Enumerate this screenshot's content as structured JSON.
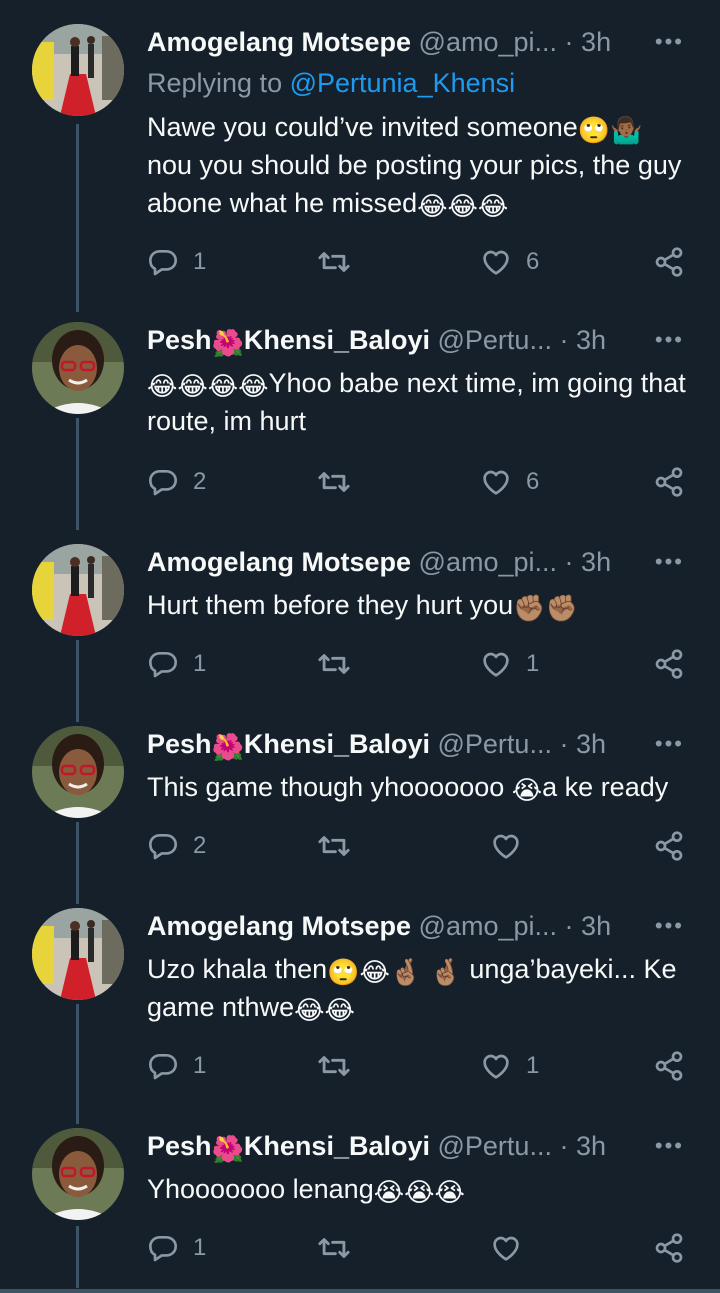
{
  "tweets": [
    {
      "author": "Amogelang Motsepe",
      "handle": "@amo_pi...",
      "dot": "·",
      "time": "3h",
      "replying_prefix": "Replying to ",
      "replying_handle": "@Pertunia_Khensi",
      "text_a": "Nawe you could’ve invited someone",
      "emoji_a": "🙄🤷🏾‍♂️",
      "text_b": "nou you should be posting your pics, the guy abone what he missed",
      "emoji_b": "😂😂😂",
      "replies": "1",
      "likes": "6",
      "avatar": "red-carpet-photo"
    },
    {
      "author_a": "Pesh",
      "name_emoji": "🌺",
      "author_b": "Khensi_Baloyi",
      "handle": "@Pertu...",
      "dot": "·",
      "time": "3h",
      "emoji_a": "😂😂😂😂",
      "text_a": "Yhoo babe next time, im going that route, im hurt",
      "replies": "2",
      "likes": "6",
      "avatar": "woman-with-glasses-photo"
    },
    {
      "author": "Amogelang Motsepe",
      "handle": "@amo_pi...",
      "dot": "·",
      "time": "3h",
      "text_a": "Hurt them before they hurt you",
      "emoji_a": "✊🏽✊🏽",
      "replies": "1",
      "likes": "1",
      "avatar": "red-carpet-photo"
    },
    {
      "author_a": "Pesh",
      "name_emoji": "🌺",
      "author_b": "Khensi_Baloyi",
      "handle": "@Pertu...",
      "dot": "·",
      "time": "3h",
      "text_a": "This game though yhooooooo ",
      "emoji_a": "😭",
      "text_b": "a ke ready",
      "replies": "2",
      "likes": "",
      "avatar": "woman-with-glasses-photo"
    },
    {
      "author": "Amogelang Motsepe",
      "handle": "@amo_pi...",
      "dot": "·",
      "time": "3h",
      "text_a": "Uzo khala then",
      "emoji_a": "🙄😂🤞🏽 🤞🏽",
      "text_b": "unga’bayeki... Ke game nthwe",
      "emoji_b": "😂😂",
      "replies": "1",
      "likes": "1",
      "avatar": "red-carpet-photo"
    },
    {
      "author_a": "Pesh",
      "name_emoji": "🌺",
      "author_b": "Khensi_Baloyi",
      "handle": "@Pertu...",
      "dot": "·",
      "time": "3h",
      "text_a": "Yhooooooo lenang",
      "emoji_a": "😭😭😭",
      "replies": "1",
      "likes": "",
      "avatar": "woman-with-glasses-photo"
    }
  ],
  "more_icon": "•••",
  "colors": {
    "background": "#15202b",
    "muted": "#8b98a5",
    "link": "#1d9bf0",
    "thread_line": "#3d5466"
  }
}
